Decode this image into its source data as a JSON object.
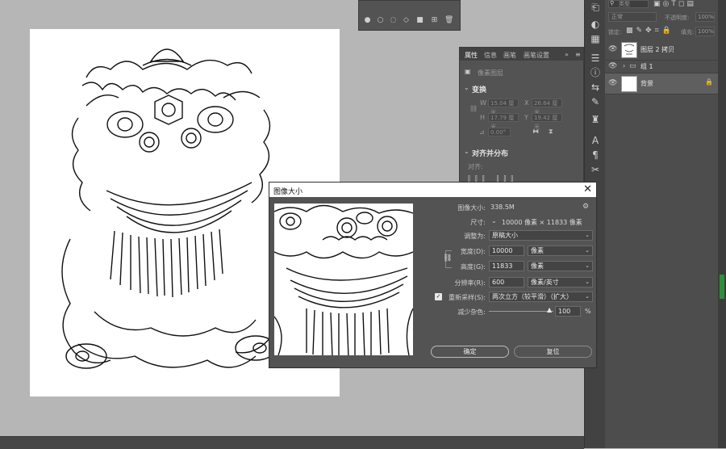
{
  "mini_panel": {
    "icons": [
      "circle-icon",
      "circle-outline-icon",
      "dotted-circle-icon",
      "diamond-icon",
      "square-fill-icon",
      "plus-square-icon",
      "trash-icon"
    ]
  },
  "properties_panel": {
    "tabs": [
      "属性",
      "信息",
      "画笔",
      "画笔设置"
    ],
    "layer_type": "像素图层",
    "transform_title": "变换",
    "w_label": "W",
    "w_value": "15.04 厘米",
    "h_label": "H",
    "h_value": "17.79 厘米",
    "x_label": "X",
    "x_value": "26.64 厘米",
    "y_label": "Y",
    "y_value": "19.42 厘米",
    "angle_value": "0.00°",
    "align_title": "对齐并分布",
    "align_label": "对齐:"
  },
  "layers_panel": {
    "search_placeholder": "类型",
    "blend_mode": "正常",
    "opacity_label": "不透明度:",
    "opacity_value": "100%",
    "lock_label": "锁定:",
    "fill_label": "填充:",
    "fill_value": "100%",
    "layers": [
      {
        "name": "图层 2 拷贝"
      },
      {
        "name": "组 1"
      },
      {
        "name": "背景"
      }
    ]
  },
  "dialog": {
    "title": "图像大小",
    "image_size_label": "图像大小:",
    "image_size_value": "338.5M",
    "dimensions_label": "尺寸:",
    "dimensions_value": "10000 像素 × 11833 像素",
    "fit_to_label": "调整为:",
    "fit_to_value": "原稿大小",
    "width_label": "宽度(D):",
    "width_value": "10000",
    "width_unit": "像素",
    "height_label": "高度(G):",
    "height_value": "11833",
    "height_unit": "像素",
    "resolution_label": "分辨率(R):",
    "resolution_value": "600",
    "resolution_unit": "像素/英寸",
    "resample_label": "重新采样(S):",
    "resample_value": "两次立方（较平滑）（扩大）",
    "noise_label": "减少杂色:",
    "noise_value": "100",
    "noise_unit": "%",
    "ok_label": "确定",
    "reset_label": "复位"
  }
}
